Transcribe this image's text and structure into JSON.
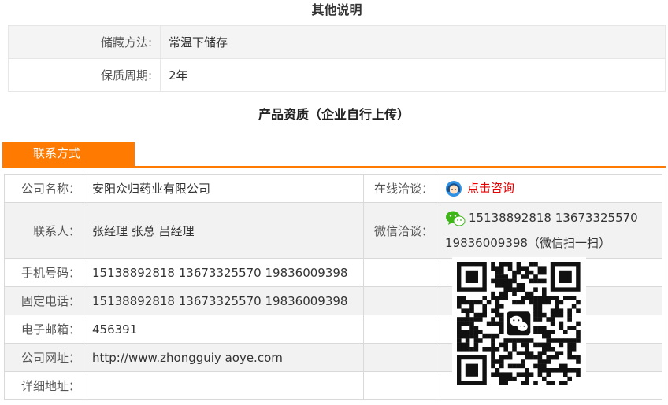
{
  "other": {
    "title": "其他说明",
    "rows": [
      {
        "label": "储藏方法:",
        "value": "常温下储存"
      },
      {
        "label": "保质周期:",
        "value": "2年"
      }
    ]
  },
  "qualification": {
    "title": "产品资质（企业自行上传）"
  },
  "contact": {
    "tab": "联系方式",
    "company_label": "公司名称：",
    "company_value": "安阳众归药业有限公司",
    "online_label": "在线洽谈：",
    "online_link": "点击咨询",
    "person_label": "联系人：",
    "person_value": "张经理 张总 吕经理",
    "wechat_label": "微信洽谈：",
    "wechat_line1": "15138892818 13673325570",
    "wechat_line2": "19836009398（微信扫一扫）",
    "mobile_label": "手机号码：",
    "mobile_value": "15138892818 13673325570 19836009398",
    "phone_label": "固定电话：",
    "phone_value": "15138892818 13673325570 19836009398",
    "email_label": "电子邮箱：",
    "email_value": "456391",
    "website_label": "公司网址：",
    "website_value": "http://www.zhongguiy aoye.com",
    "address_label": "详细地址：",
    "address_value": ""
  },
  "icons": {
    "service": "customer-service-icon",
    "wechat": "wechat-icon",
    "qr": "wechat-qr-code"
  },
  "colors": {
    "accent": "#ff7a00",
    "link": "#e60000",
    "wechat": "#3fb618"
  }
}
